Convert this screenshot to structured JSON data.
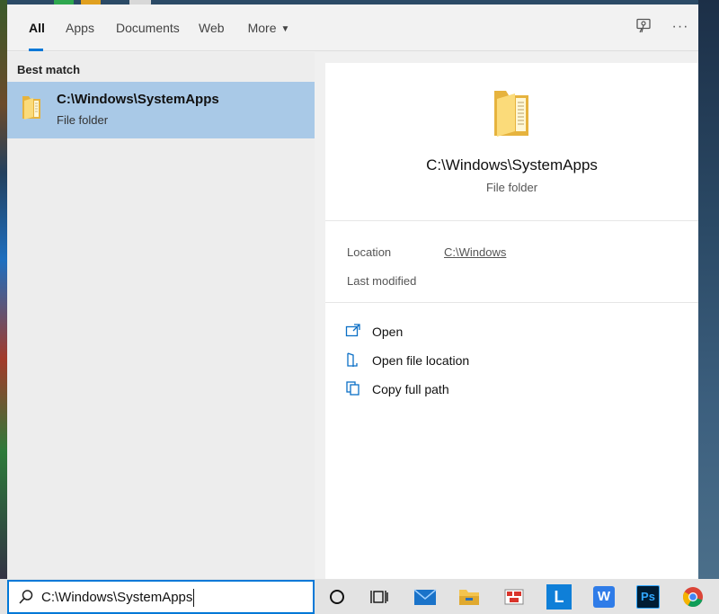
{
  "tabs": [
    {
      "label": "All",
      "active": true
    },
    {
      "label": "Apps"
    },
    {
      "label": "Documents"
    },
    {
      "label": "Web"
    },
    {
      "label": "More"
    }
  ],
  "toolbar": {
    "feedback_icon": "feedback-icon",
    "more_options_glyph": "···"
  },
  "results": {
    "heading": "Best match",
    "best_match": {
      "title": "C:\\Windows\\SystemApps",
      "subtitle": "File folder",
      "icon": "folder-icon"
    }
  },
  "preview": {
    "title": "C:\\Windows\\SystemApps",
    "subtitle": "File folder",
    "properties": [
      {
        "label": "Location",
        "value": "C:\\Windows"
      },
      {
        "label": "Last modified",
        "value": ""
      }
    ],
    "actions": [
      {
        "label": "Open",
        "icon": "open-icon"
      },
      {
        "label": "Open file location",
        "icon": "file-location-icon"
      },
      {
        "label": "Copy full path",
        "icon": "copy-icon"
      }
    ]
  },
  "taskbar": {
    "search_value": "C:\\Windows\\SystemApps",
    "apps": [
      "cortana-icon",
      "task-view-icon",
      "mail-icon",
      "file-explorer-icon",
      "pinned-app-icon",
      "l-app-icon",
      "wps-icon",
      "photoshop-icon",
      "chrome-icon"
    ],
    "app_labels": {
      "l_app": "L",
      "wps": "W",
      "photoshop": "Ps"
    }
  },
  "colors": {
    "accent": "#0078d7",
    "selection": "#a9c9e7",
    "folder": "#f4c44e"
  }
}
